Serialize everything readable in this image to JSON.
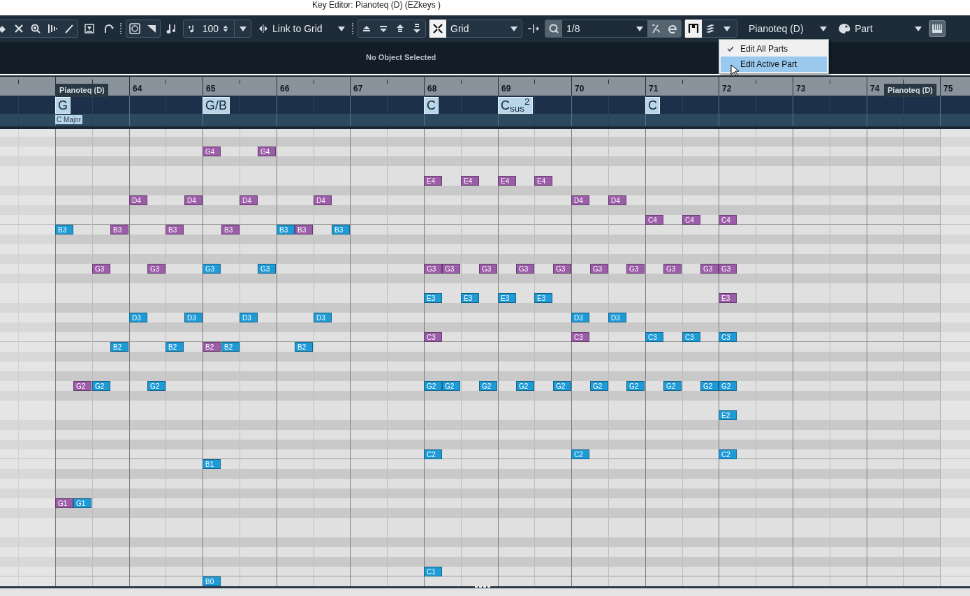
{
  "window": {
    "title": "Key Editor: Pianoteq  (D) (EZkeys )"
  },
  "toolbar": {
    "velocity": "100",
    "link_mode": "Link to Grid",
    "snap": {
      "on": true
    },
    "grid_type": "Grid",
    "quantize": "1/8",
    "part_display": {
      "on": true
    },
    "part": "Pianoteq  (D)",
    "edit_scope": "Part"
  },
  "menu": [
    {
      "label": "Edit All Parts",
      "checked": true,
      "selected": false
    },
    {
      "label": "Edit Active Part",
      "checked": false,
      "selected": true
    }
  ],
  "info_line": "No Object Selected",
  "measures": [
    {
      "part_label": "Pianoteq  (D)",
      "beats": [
        {
          "chord": "G",
          "scale": "C Major",
          "notes": [
            {
              "pitch": "B3",
              "color": "#1e9ad6"
            },
            {
              "pitch": "G1",
              "color": "#9b5ca8"
            }
          ]
        },
        {
          "notes": [
            {
              "pitch": "G2",
              "color": "#9b5ca8"
            },
            {
              "pitch": "G1",
              "color": "#1e9ad6"
            }
          ]
        },
        {
          "notes": [
            {
              "pitch": "G3",
              "color": "#9b5ca8"
            },
            {
              "pitch": "G2",
              "color": "#1e9ad6"
            }
          ]
        },
        {
          "notes": [
            {
              "pitch": "B3",
              "color": "#9b5ca8"
            },
            {
              "pitch": "B2",
              "color": "#1e9ad6"
            }
          ]
        }
      ]
    },
    {
      "number": "64",
      "beats": [
        {
          "notes": [
            {
              "pitch": "D4",
              "color": "#9b5ca8"
            },
            {
              "pitch": "D3",
              "color": "#1e9ad6"
            }
          ]
        },
        {
          "notes": [
            {
              "pitch": "G3",
              "color": "#9b5ca8"
            },
            {
              "pitch": "G2",
              "color": "#1e9ad6"
            }
          ]
        },
        {
          "notes": [
            {
              "pitch": "B3",
              "color": "#9b5ca8"
            },
            {
              "pitch": "B2",
              "color": "#1e9ad6"
            }
          ]
        },
        {
          "notes": [
            {
              "pitch": "D4",
              "color": "#9b5ca8"
            },
            {
              "pitch": "D3",
              "color": "#1e9ad6"
            }
          ]
        }
      ]
    },
    {
      "number": "65",
      "beats": [
        {
          "chord": "G/B",
          "notes": [
            {
              "pitch": "G4",
              "color": "#9b5ca8"
            },
            {
              "pitch": "G3",
              "color": "#1e9ad6"
            },
            {
              "pitch": "B2",
              "color": "#9b5ca8"
            },
            {
              "pitch": "B1",
              "color": "#1e9ad6"
            },
            {
              "pitch": "B0",
              "color": "#1e9ad6"
            }
          ]
        },
        {
          "notes": [
            {
              "pitch": "B3",
              "color": "#9b5ca8"
            },
            {
              "pitch": "B2",
              "color": "#1e9ad6"
            }
          ]
        },
        {
          "notes": [
            {
              "pitch": "D4",
              "color": "#9b5ca8"
            },
            {
              "pitch": "D3",
              "color": "#1e9ad6"
            }
          ]
        },
        {
          "notes": [
            {
              "pitch": "G4",
              "color": "#9b5ca8"
            },
            {
              "pitch": "G3",
              "color": "#1e9ad6"
            }
          ]
        }
      ]
    },
    {
      "number": "66",
      "beats": [
        {
          "notes": [
            {
              "pitch": "B3",
              "color": "#1e9ad6"
            }
          ]
        },
        {
          "notes": [
            {
              "pitch": "B3",
              "color": "#9b5ca8"
            },
            {
              "pitch": "B2",
              "color": "#1e9ad6"
            }
          ]
        },
        {
          "notes": [
            {
              "pitch": "D4",
              "color": "#9b5ca8"
            },
            {
              "pitch": "D3",
              "color": "#1e9ad6"
            }
          ]
        },
        {
          "notes": [
            {
              "pitch": "B3",
              "color": "#1e9ad6"
            }
          ]
        }
      ]
    },
    {
      "number": "67"
    },
    {
      "number": "68",
      "beats": [
        {
          "chord": "C",
          "notes": [
            {
              "pitch": "E4",
              "color": "#9b5ca8"
            },
            {
              "pitch": "G3",
              "color": "#9b5ca8"
            },
            {
              "pitch": "E3",
              "color": "#1e9ad6"
            },
            {
              "pitch": "C3",
              "color": "#9b5ca8"
            },
            {
              "pitch": "G2",
              "color": "#1e9ad6"
            },
            {
              "pitch": "C2",
              "color": "#1e9ad6"
            },
            {
              "pitch": "C1",
              "color": "#1e9ad6"
            }
          ]
        },
        {
          "notes": [
            {
              "pitch": "G3",
              "color": "#9b5ca8"
            },
            {
              "pitch": "G2",
              "color": "#1e9ad6"
            }
          ]
        },
        {
          "notes": [
            {
              "pitch": "E4",
              "color": "#9b5ca8"
            },
            {
              "pitch": "E3",
              "color": "#1e9ad6"
            }
          ]
        },
        {
          "notes": [
            {
              "pitch": "G3",
              "color": "#9b5ca8"
            },
            {
              "pitch": "G2",
              "color": "#1e9ad6"
            }
          ]
        }
      ]
    },
    {
      "number": "69",
      "beats": [
        {
          "chord": "C$_{sus}$$^{2}$",
          "notes": [
            {
              "pitch": "E4",
              "color": "#9b5ca8"
            },
            {
              "pitch": "E3",
              "color": "#1e9ad6"
            }
          ]
        },
        {
          "notes": [
            {
              "pitch": "G3",
              "color": "#9b5ca8"
            },
            {
              "pitch": "G2",
              "color": "#1e9ad6"
            }
          ]
        },
        {
          "notes": [
            {
              "pitch": "E4",
              "color": "#9b5ca8"
            },
            {
              "pitch": "E3",
              "color": "#1e9ad6"
            }
          ]
        },
        {
          "notes": [
            {
              "pitch": "G3",
              "color": "#9b5ca8"
            },
            {
              "pitch": "G2",
              "color": "#1e9ad6"
            }
          ]
        }
      ]
    },
    {
      "number": "70",
      "beats": [
        {
          "notes": [
            {
              "pitch": "D4",
              "color": "#9b5ca8"
            },
            {
              "pitch": "D3",
              "color": "#1e9ad6"
            },
            {
              "pitch": "C3",
              "color": "#9b5ca8"
            },
            {
              "pitch": "C2",
              "color": "#1e9ad6"
            }
          ]
        },
        {
          "notes": [
            {
              "pitch": "G3",
              "color": "#9b5ca8"
            },
            {
              "pitch": "G2",
              "color": "#1e9ad6"
            }
          ]
        },
        {
          "notes": [
            {
              "pitch": "D4",
              "color": "#9b5ca8"
            },
            {
              "pitch": "D3",
              "color": "#1e9ad6"
            }
          ]
        },
        {
          "notes": [
            {
              "pitch": "G3",
              "color": "#9b5ca8"
            },
            {
              "pitch": "G2",
              "color": "#1e9ad6"
            }
          ]
        }
      ]
    },
    {
      "number": "71",
      "beats": [
        {
          "chord": "C",
          "notes": [
            {
              "pitch": "C4",
              "color": "#9b5ca8"
            },
            {
              "pitch": "C3",
              "color": "#1e9ad6"
            }
          ]
        },
        {
          "notes": [
            {
              "pitch": "G3",
              "color": "#9b5ca8"
            },
            {
              "pitch": "G2",
              "color": "#1e9ad6"
            }
          ]
        },
        {
          "notes": [
            {
              "pitch": "C4",
              "color": "#9b5ca8"
            },
            {
              "pitch": "C3",
              "color": "#1e9ad6"
            }
          ]
        },
        {
          "notes": [
            {
              "pitch": "G3",
              "color": "#9b5ca8"
            },
            {
              "pitch": "G2",
              "color": "#1e9ad6"
            }
          ]
        }
      ]
    },
    {
      "number": "72",
      "beats": [
        {
          "notes": [
            {
              "pitch": "C4",
              "color": "#9b5ca8"
            },
            {
              "pitch": "G3",
              "color": "#9b5ca8"
            },
            {
              "pitch": "E3",
              "color": "#9b5ca8"
            },
            {
              "pitch": "C3",
              "color": "#1e9ad6"
            },
            {
              "pitch": "G2",
              "color": "#1e9ad6"
            },
            {
              "pitch": "E2",
              "color": "#1e9ad6"
            },
            {
              "pitch": "C2",
              "color": "#1e9ad6"
            }
          ]
        }
      ]
    },
    {
      "number": "73"
    },
    {
      "number": "74",
      "part_label": "Pianoteq  (D)"
    },
    {
      "number": "75"
    }
  ]
}
